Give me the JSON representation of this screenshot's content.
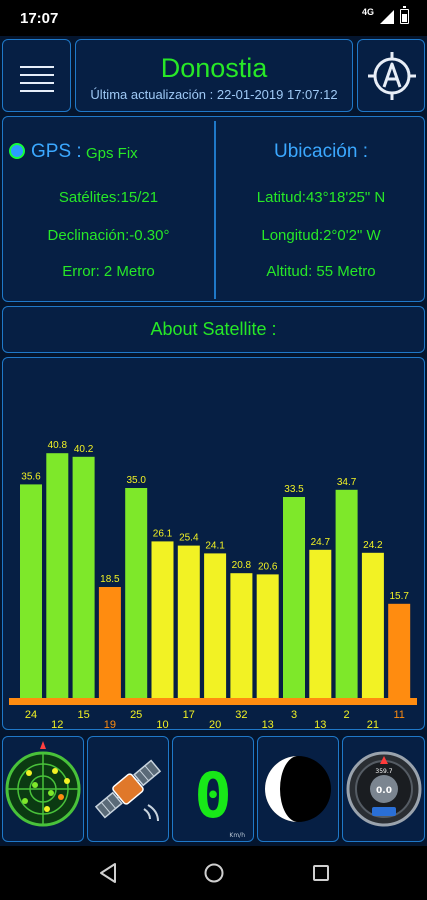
{
  "status_bar": {
    "time": "17:07",
    "network": "4G"
  },
  "header": {
    "city": "Donostia",
    "updated": "Última actualización : 22-01-2019 17:07:12"
  },
  "gps": {
    "label": "GPS :",
    "status": "Gps Fix",
    "satellites": "Satélites:15/21",
    "declination": "Declinación:-0.30°",
    "error": "Error: 2 Metro"
  },
  "location": {
    "title": "Ubicación :",
    "latitude": "Latitud:43°18'25\" N",
    "longitude": "Longitud:2°0'2\" W",
    "altitude": "Altitud: 55 Metro"
  },
  "about": {
    "label": "About Satellite :"
  },
  "chart_data": {
    "type": "bar",
    "categories": [
      "24",
      "12",
      "15",
      "19",
      "25",
      "10",
      "17",
      "20",
      "32",
      "13",
      "3",
      "13",
      "2",
      "21",
      "11"
    ],
    "values": [
      35.6,
      40.8,
      40.2,
      18.5,
      35.0,
      26.1,
      25.4,
      24.1,
      20.8,
      20.6,
      33.5,
      24.7,
      34.7,
      24.2,
      15.7
    ],
    "ylim": [
      0,
      50
    ],
    "colors": {
      "high": "#7ee82a",
      "mid": "#f2f224",
      "low": "#ff8c10",
      "baseline": "#ff8c10"
    },
    "value_label_color": "#f2f224",
    "category_colors": [
      "#f2f224",
      "#f2f224",
      "#f2f224",
      "#ff8c10",
      "#f2f224",
      "#f2f224",
      "#f2f224",
      "#f2f224",
      "#f2f224",
      "#f2f224",
      "#f2f224",
      "#f2f224",
      "#f2f224",
      "#f2f224",
      "#ff8c10"
    ]
  },
  "tools": {
    "speed_value": "0",
    "speed_unit": "Km/h",
    "compass_speed": "0.0",
    "compass_top": "359.7"
  },
  "colors": {
    "accent_green": "#27e827",
    "accent_blue": "#3ba8ff",
    "panel_border": "#1f78c8",
    "panel_bg": "#061f44"
  },
  "icons": {
    "menu": "hamburger-icon",
    "logo": "compass-a-icon",
    "radar": "radar-icon",
    "satellite": "satellite-icon",
    "speed": "speedometer-icon",
    "moon": "moon-phase-icon",
    "compass": "compass-icon"
  }
}
